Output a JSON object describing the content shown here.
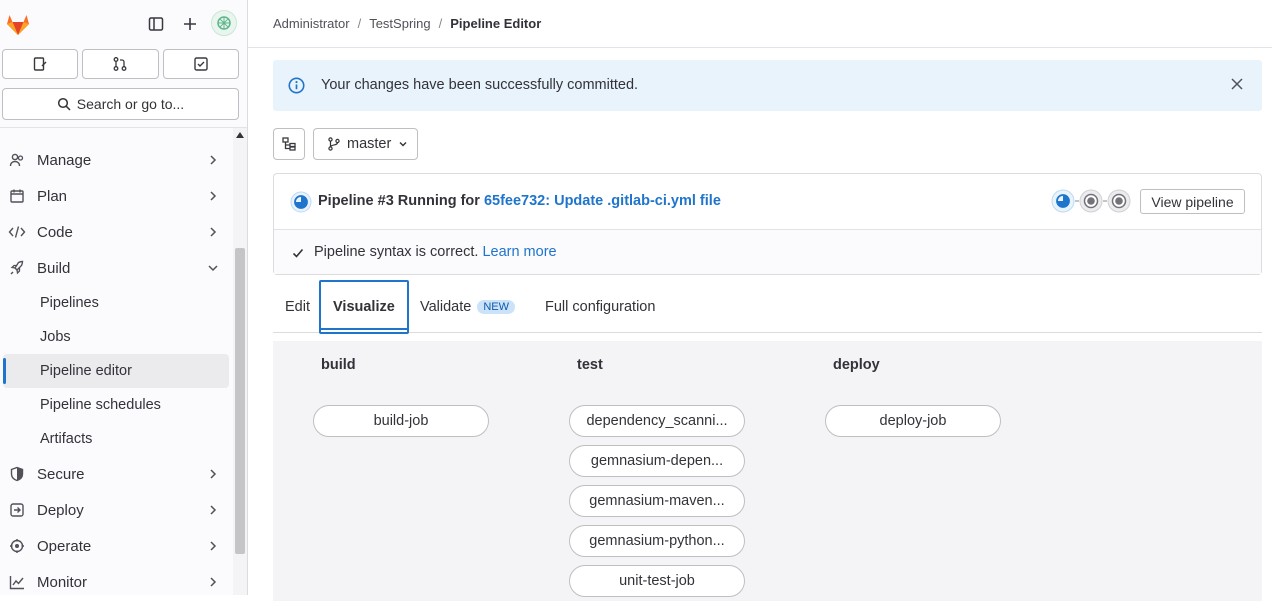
{
  "sidebar": {
    "search_label": "Search or go to...",
    "nav": {
      "manage": "Manage",
      "plan": "Plan",
      "code": "Code",
      "build": "Build",
      "build_items": [
        "Pipelines",
        "Jobs",
        "Pipeline editor",
        "Pipeline schedules",
        "Artifacts"
      ],
      "secure": "Secure",
      "deploy": "Deploy",
      "operate": "Operate",
      "monitor": "Monitor"
    }
  },
  "breadcrumb": [
    "Administrator",
    "TestSpring",
    "Pipeline Editor"
  ],
  "alert": {
    "message": "Your changes have been successfully committed."
  },
  "branch": "master",
  "pipeline": {
    "status_text": "Pipeline #3 Running for",
    "commit_link": "65fee732: Update .gitlab-ci.yml file",
    "view_button": "View pipeline",
    "syntax_text": "Pipeline syntax is correct.",
    "learn_more": "Learn more"
  },
  "tabs": {
    "edit": "Edit",
    "visualize": "Visualize",
    "validate": "Validate",
    "validate_badge": "NEW",
    "full_config": "Full configuration"
  },
  "stages": {
    "build": {
      "title": "build",
      "jobs": [
        "build-job"
      ]
    },
    "test": {
      "title": "test",
      "jobs": [
        "dependency_scanni...",
        "gemnasium-depen...",
        "gemnasium-maven...",
        "gemnasium-python...",
        "unit-test-job"
      ]
    },
    "deploy": {
      "title": "deploy",
      "jobs": [
        "deploy-job"
      ]
    }
  },
  "colors": {
    "brand": "#fc6d26",
    "link": "#1f75cb",
    "alert_bg": "#e9f3fc"
  }
}
